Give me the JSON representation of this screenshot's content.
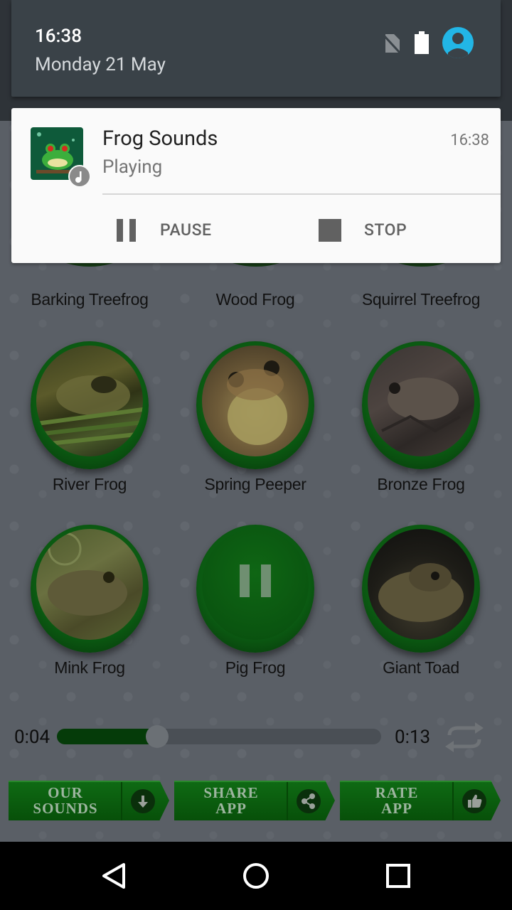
{
  "status": {
    "time": "16:38",
    "date": "Monday 21 May"
  },
  "notification": {
    "app_title": "Frog Sounds",
    "state": "Playing",
    "time": "16:38",
    "pause_label": "PAUSE",
    "stop_label": "STOP"
  },
  "frogs": [
    {
      "name": "Barking Treefrog"
    },
    {
      "name": "Wood Frog"
    },
    {
      "name": "Squirrel Treefrog"
    },
    {
      "name": "River Frog"
    },
    {
      "name": "Spring Peeper"
    },
    {
      "name": "Bronze Frog"
    },
    {
      "name": "Mink Frog"
    },
    {
      "name": "Pig Frog"
    },
    {
      "name": "Giant Toad"
    }
  ],
  "player": {
    "elapsed": "0:04",
    "duration": "0:13",
    "progress": 0.31
  },
  "bottom_buttons": {
    "our_sounds_1": "OUR",
    "our_sounds_2": "SOUNDS",
    "share_1": "SHARE",
    "share_2": "APP",
    "rate_1": "RATE",
    "rate_2": "APP"
  },
  "icons": {
    "no_sim": "no-sim-icon",
    "battery": "battery-icon",
    "user": "user-avatar-icon",
    "music": "music-note-icon",
    "pause": "pause-icon",
    "stop": "stop-icon",
    "repeat": "repeat-icon",
    "download": "download-icon",
    "share": "share-icon",
    "thumbs_up": "thumbs-up-icon",
    "back": "back-icon",
    "home": "home-icon",
    "recents": "recents-icon"
  },
  "colors": {
    "accent_green": "#0b5a12",
    "avatar_blue": "#22b6e6"
  }
}
